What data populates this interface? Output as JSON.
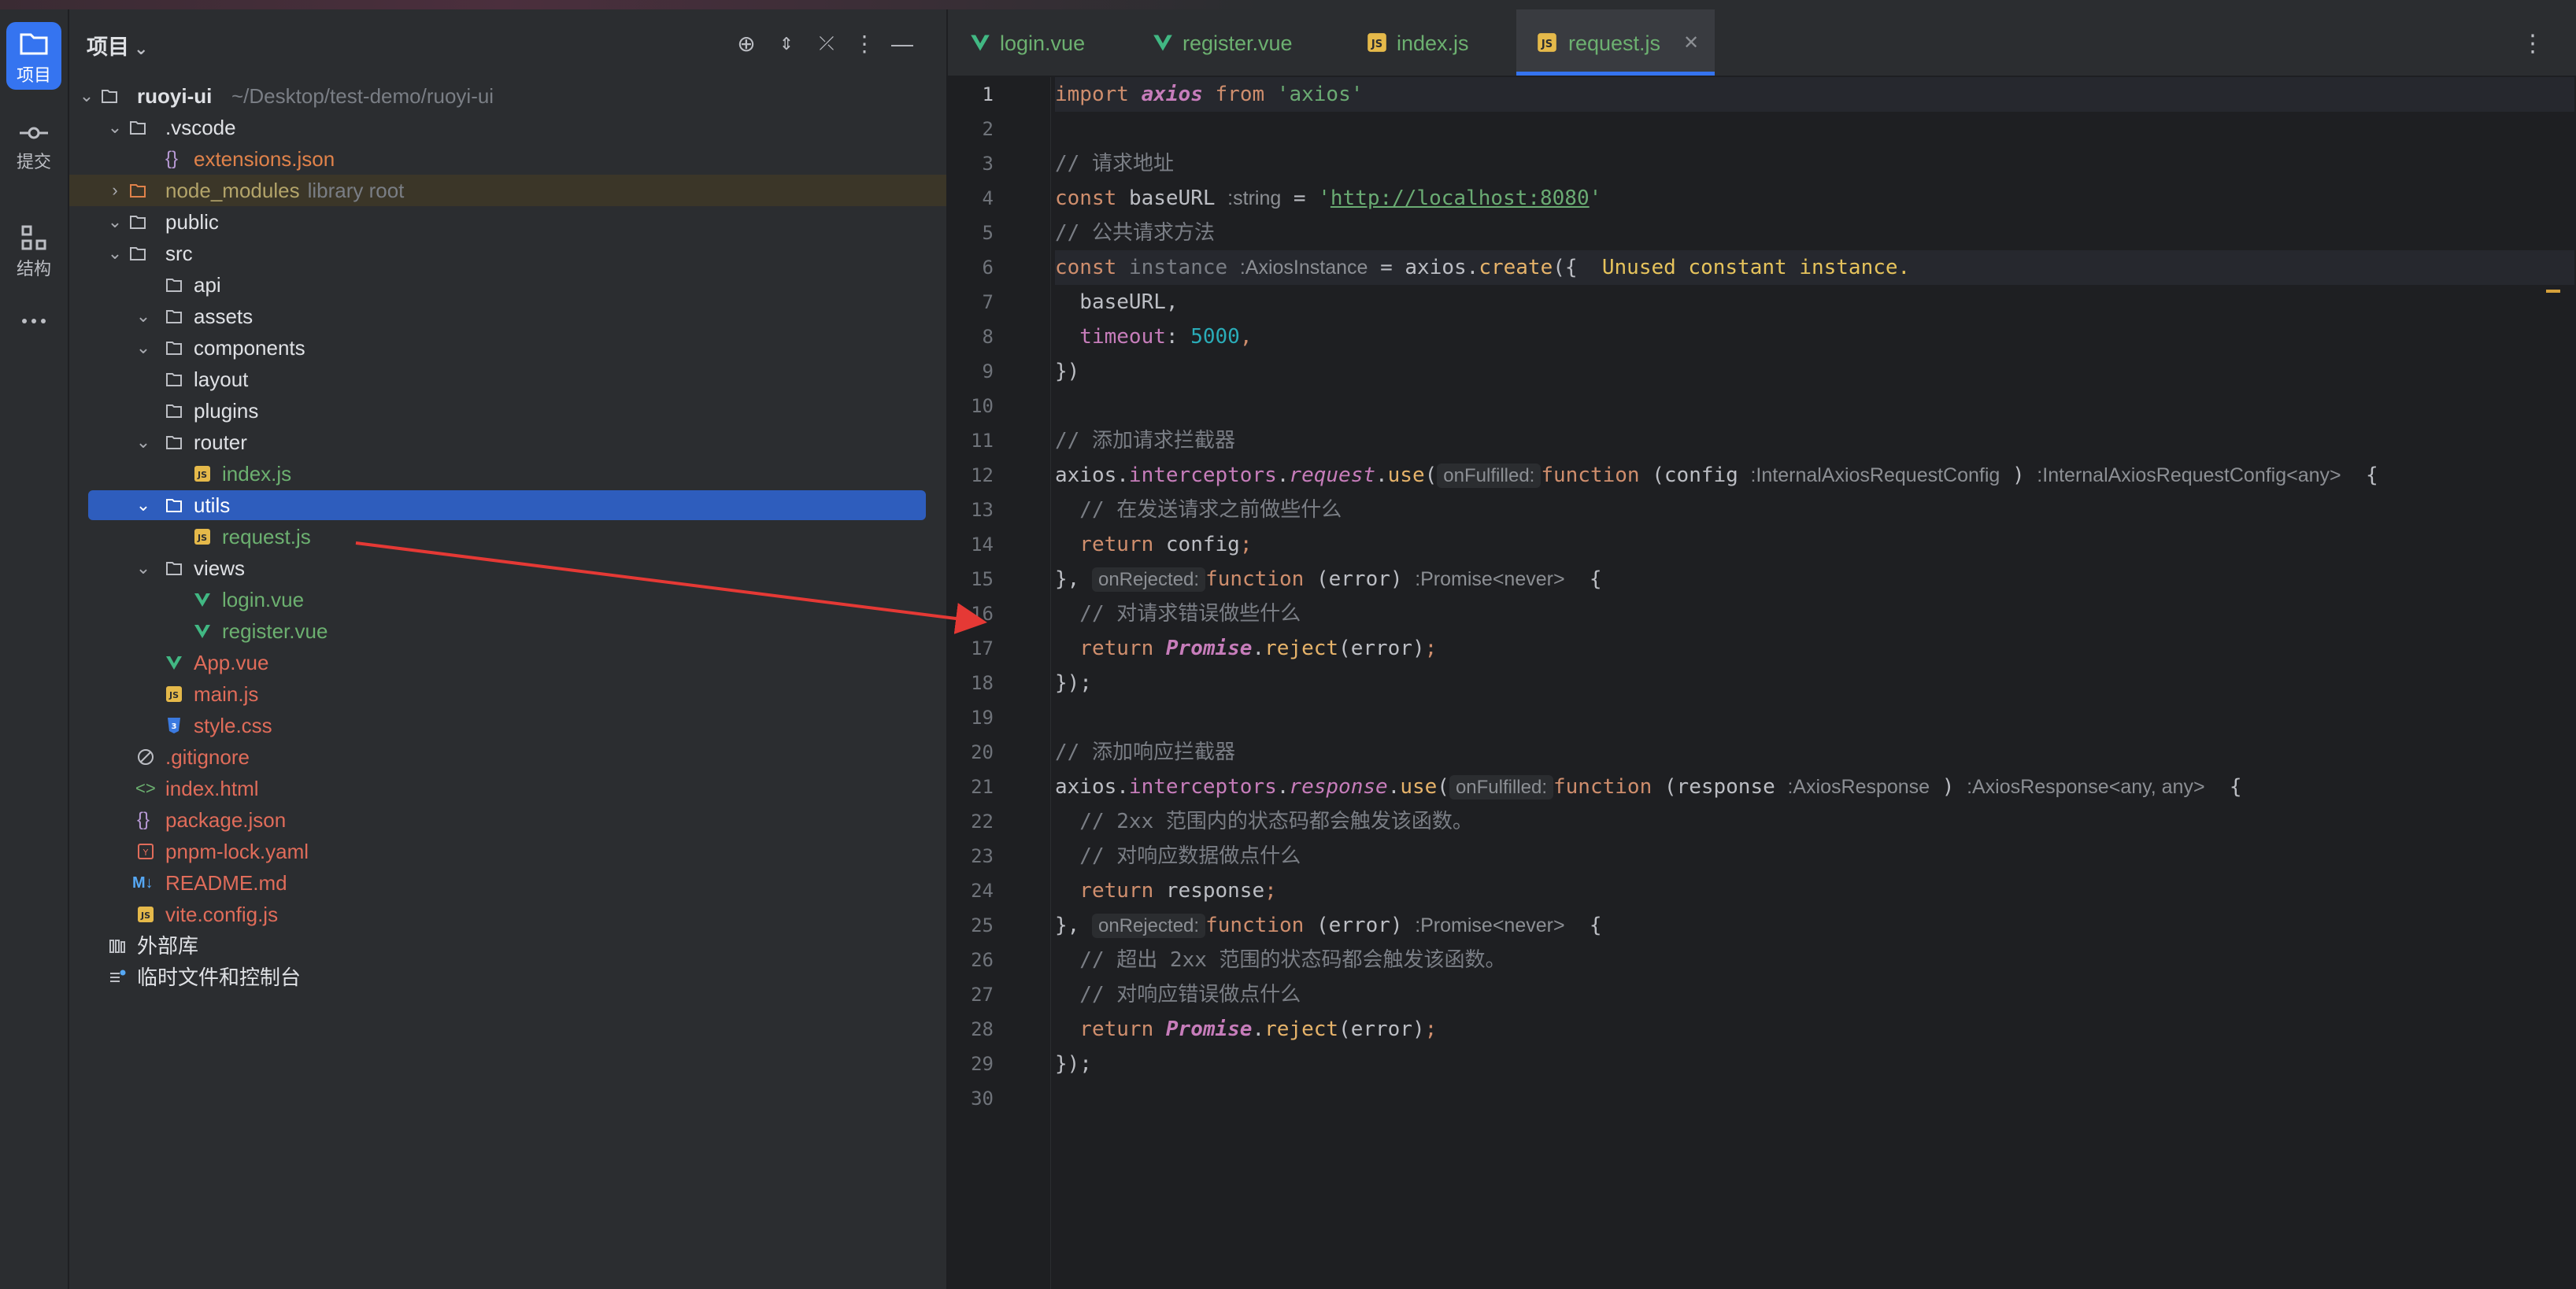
{
  "activity": [
    {
      "label": "项目",
      "icon": "folder-icon",
      "active": true
    },
    {
      "label": "提交",
      "icon": "commit-icon",
      "active": false
    },
    {
      "label": "结构",
      "icon": "structure-icon",
      "active": false
    },
    {
      "label": "",
      "icon": "more-icon",
      "active": false
    }
  ],
  "project": {
    "title": "项目",
    "root_name": "ruoyi-ui",
    "root_path": "~/Desktop/test-demo/ruoyi-ui",
    "library_hint": "library root",
    "tree": [
      {
        "label": ".vscode"
      },
      {
        "label": "extensions.json"
      },
      {
        "label": "node_modules"
      },
      {
        "label": "public"
      },
      {
        "label": "src"
      },
      {
        "label": "api"
      },
      {
        "label": "assets"
      },
      {
        "label": "components"
      },
      {
        "label": "layout"
      },
      {
        "label": "plugins"
      },
      {
        "label": "router"
      },
      {
        "label": "index.js"
      },
      {
        "label": "utils"
      },
      {
        "label": "request.js"
      },
      {
        "label": "views"
      },
      {
        "label": "login.vue"
      },
      {
        "label": "register.vue"
      },
      {
        "label": "App.vue"
      },
      {
        "label": "main.js"
      },
      {
        "label": "style.css"
      },
      {
        "label": ".gitignore"
      },
      {
        "label": "index.html"
      },
      {
        "label": "package.json"
      },
      {
        "label": "pnpm-lock.yaml"
      },
      {
        "label": "README.md"
      },
      {
        "label": "vite.config.js"
      },
      {
        "label": "外部库"
      },
      {
        "label": "临时文件和控制台"
      }
    ]
  },
  "tabs": [
    {
      "label": "login.vue"
    },
    {
      "label": "register.vue"
    },
    {
      "label": "index.js"
    },
    {
      "label": "request.js"
    }
  ],
  "editor": {
    "warning_count": "1",
    "line_numbers": [
      "1",
      "2",
      "3",
      "4",
      "5",
      "6",
      "7",
      "8",
      "9",
      "10",
      "11",
      "12",
      "13",
      "14",
      "15",
      "16",
      "17",
      "18",
      "19",
      "20",
      "21",
      "22",
      "23",
      "24",
      "25",
      "26",
      "27",
      "28",
      "29",
      "30"
    ],
    "code": {
      "l1_import": "import",
      "l1_axios": "axios",
      "l1_from": "from",
      "l1_str": "'axios'",
      "l3": "// 请求地址",
      "l4_const": "const",
      "l4_name": "baseURL",
      "l4_hint": ":string",
      "l4_eq": " = ",
      "l4_q1": "'",
      "l4_url": "http://localhost:8080",
      "l4_q2": "'",
      "l5": "// 公共请求方法",
      "l6_const": "const",
      "l6_name": "instance",
      "l6_hint": ":AxiosInstance",
      "l6_rest": " = axios.",
      "l6_create": "create",
      "l6_brace": "({",
      "l6_warn": "Unused constant instance.",
      "l7": "  baseURL,",
      "l8_key": "  timeout",
      "l8_colon": ": ",
      "l8_num": "5000",
      "l8_comma": ",",
      "l9": "})",
      "l11": "// 添加请求拦截器",
      "l12_axios": "axios.",
      "l12_inter": "interceptors",
      "l12_dot": ".",
      "l12_req": "request",
      "l12_dot2": ".",
      "l12_use": "use",
      "l12_paren": "(",
      "l12_chip": "onFulfilled:",
      "l12_function": "function",
      "l12_param": "(config",
      "l12_phint": ":InternalAxiosRequestConfig",
      "l12_close": ")",
      "l12_rhint": ":InternalAxiosRequestConfig<any>",
      "l12_brace": "{",
      "l13": "  // 在发送请求之前做些什么",
      "l14_return": "  return",
      "l14_rest": " config",
      "l14_semi": ";",
      "l15_close": "},",
      "l15_chip": "onRejected:",
      "l15_function": "function",
      "l15_param": "(error)",
      "l15_hint": ":Promise<never>",
      "l15_brace": "{",
      "l16": "  // 对请求错误做些什么",
      "l17_return": "  return",
      "l17_promise": "Promise",
      "l17_dot": ".",
      "l17_reject": "reject",
      "l17_rest": "(error)",
      "l17_semi": ";",
      "l18": "});",
      "l20": "// 添加响应拦截器",
      "l21_axios": "axios.",
      "l21_inter": "interceptors",
      "l21_dot": ".",
      "l21_res": "response",
      "l21_dot2": ".",
      "l21_use": "use",
      "l21_paren": "(",
      "l21_chip": "onFulfilled:",
      "l21_function": "function",
      "l21_param": "(response",
      "l21_phint": ":AxiosResponse",
      "l21_close": ")",
      "l21_rhint": ":AxiosResponse<any, any>",
      "l21_brace": "{",
      "l22": "  // 2xx 范围内的状态码都会触发该函数。",
      "l23": "  // 对响应数据做点什么",
      "l24_return": "  return",
      "l24_rest": " response",
      "l24_semi": ";",
      "l25_close": "},",
      "l25_chip": "onRejected:",
      "l25_function": "function",
      "l25_param": "(error)",
      "l25_hint": ":Promise<never>",
      "l25_brace": "{",
      "l26": "  // 超出 2xx 范围的状态码都会触发该函数。",
      "l27": "  // 对响应错误做点什么",
      "l28_return": "  return",
      "l28_promise": "Promise",
      "l28_dot": ".",
      "l28_reject": "reject",
      "l28_rest": "(error)",
      "l28_semi": ";",
      "l29": "});"
    }
  },
  "colors": {
    "accent": "#3574f0",
    "selection": "#2e5dbd",
    "annotation_arrow": "#e53935",
    "warning": "#e6c35c"
  }
}
